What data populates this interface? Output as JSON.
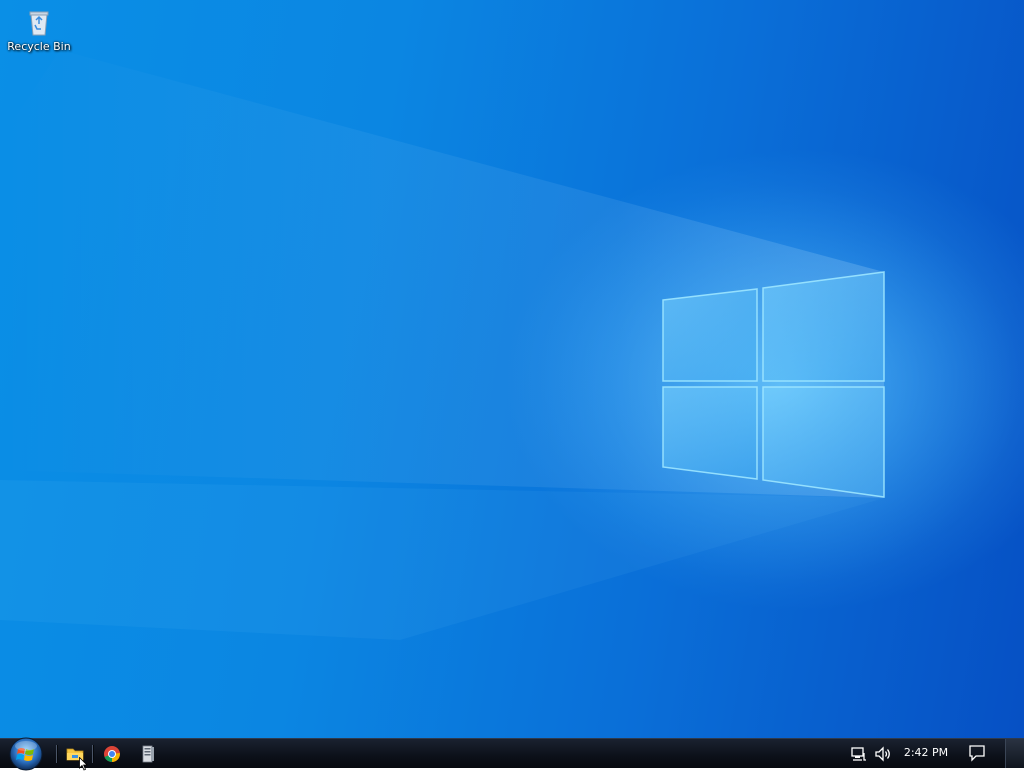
{
  "desktop": {
    "icons": [
      {
        "label": "Recycle Bin",
        "icon": "recycle-bin-icon"
      }
    ]
  },
  "taskbar": {
    "start": {
      "icon": "windows-start-orb-icon"
    },
    "pinned": [
      {
        "name": "File Explorer",
        "icon": "folder-icon",
        "active": true
      },
      {
        "name": "Google Chrome",
        "icon": "chrome-icon",
        "active": false
      },
      {
        "name": "Server app",
        "icon": "server-icon",
        "active": false
      }
    ],
    "tray": {
      "icons": [
        "network-icon",
        "volume-icon"
      ],
      "clock": "2:42 PM",
      "notification_icon": "action-center-icon"
    }
  },
  "colors": {
    "wallpaper_light": "#0a8fe6",
    "wallpaper_dark": "#0650c4",
    "taskbar": "#0c1019"
  }
}
